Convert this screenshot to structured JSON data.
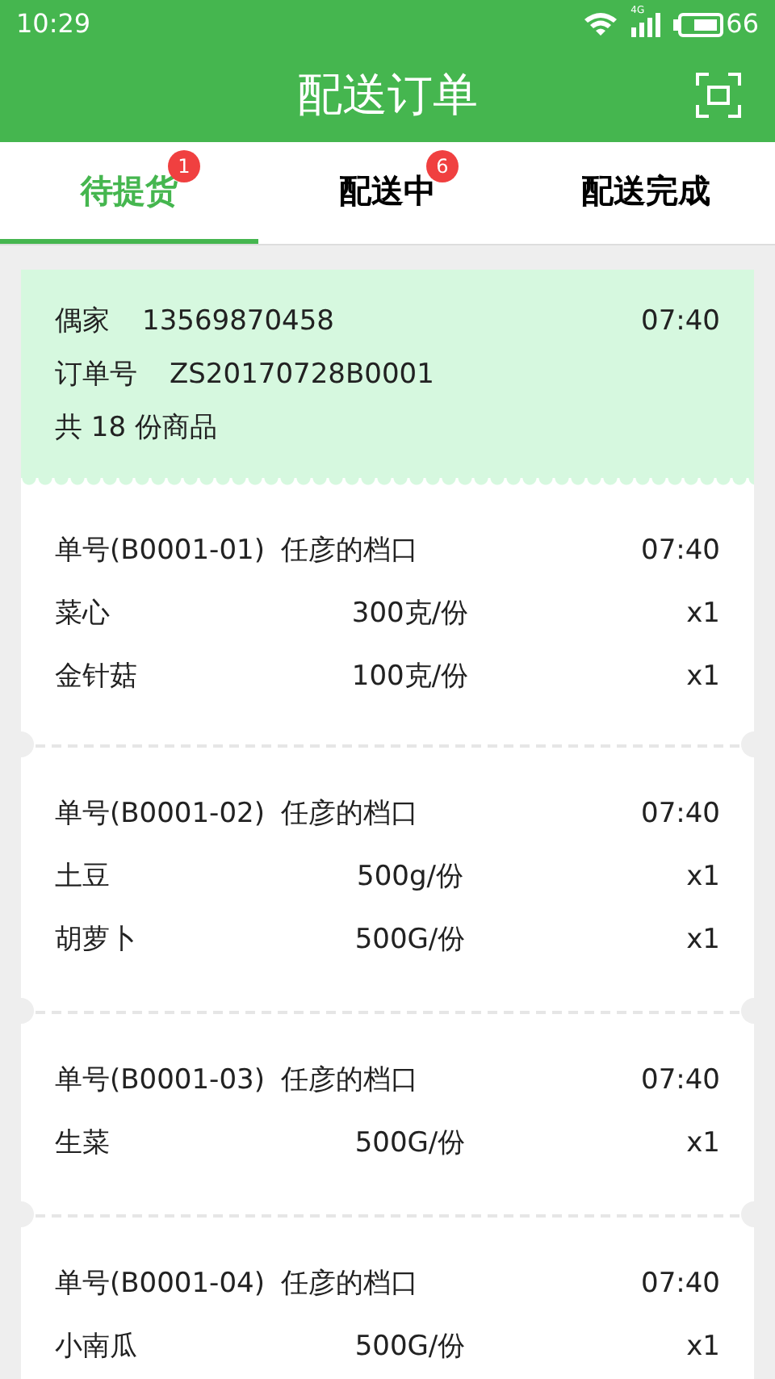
{
  "status_bar": {
    "time": "10:29",
    "network": "4G",
    "battery": "66"
  },
  "header": {
    "title": "配送订单"
  },
  "tabs": [
    {
      "label": "待提货",
      "badge": "1",
      "selected": true
    },
    {
      "label": "配送中",
      "badge": "6",
      "selected": false
    },
    {
      "label": "配送完成",
      "selected": false
    }
  ],
  "order": {
    "customer": "偶家",
    "phone": "13569870458",
    "time": "07:40",
    "order_label": "订单号",
    "order_no": "ZS20170728B0001",
    "summary": "共 18 份商品"
  },
  "sub_orders": [
    {
      "number": "单号(B0001-01)",
      "stall": "任彦的档口",
      "time": "07:40",
      "items": [
        {
          "name": "菜心",
          "spec": "300克/份",
          "qty": "x1"
        },
        {
          "name": "金针菇",
          "spec": "100克/份",
          "qty": "x1"
        }
      ]
    },
    {
      "number": "单号(B0001-02)",
      "stall": "任彦的档口",
      "time": "07:40",
      "items": [
        {
          "name": "土豆",
          "spec": "500g/份",
          "qty": "x1"
        },
        {
          "name": "胡萝卜",
          "spec": "500G/份",
          "qty": "x1"
        }
      ]
    },
    {
      "number": "单号(B0001-03)",
      "stall": "任彦的档口",
      "time": "07:40",
      "items": [
        {
          "name": "生菜",
          "spec": "500G/份",
          "qty": "x1"
        }
      ]
    },
    {
      "number": "单号(B0001-04)",
      "stall": "任彦的档口",
      "time": "07:40",
      "items": [
        {
          "name": "小南瓜",
          "spec": "500G/份",
          "qty": "x1"
        }
      ]
    }
  ]
}
